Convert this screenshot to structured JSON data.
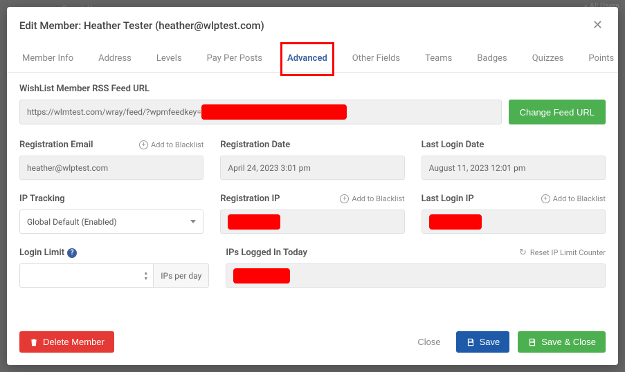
{
  "backdrop": {
    "search_users": "Search Users",
    "all_users": "« All Users"
  },
  "modal": {
    "title": "Edit Member: Heather Tester (heather@wlptest.com)"
  },
  "tabs": [
    {
      "label": "Member Info",
      "active": false
    },
    {
      "label": "Address",
      "active": false
    },
    {
      "label": "Levels",
      "active": false
    },
    {
      "label": "Pay Per Posts",
      "active": false
    },
    {
      "label": "Advanced",
      "active": true
    },
    {
      "label": "Other Fields",
      "active": false
    },
    {
      "label": "Teams",
      "active": false
    },
    {
      "label": "Badges",
      "active": false
    },
    {
      "label": "Quizzes",
      "active": false
    },
    {
      "label": "Points",
      "active": false
    }
  ],
  "feed": {
    "label": "WishList Member RSS Feed URL",
    "value": "https://wlmtest.com/wray/feed/?wpmfeedkey=",
    "change_btn": "Change Feed URL"
  },
  "row1": {
    "reg_email_label": "Registration Email",
    "reg_email_value": "heather@wlptest.com",
    "reg_date_label": "Registration Date",
    "reg_date_value": "April 24, 2023 3:01 pm",
    "last_login_date_label": "Last Login Date",
    "last_login_date_value": "August 11, 2023 12:01 pm",
    "add_blacklist": "Add to Blacklist"
  },
  "row2": {
    "ip_tracking_label": "IP Tracking",
    "ip_tracking_value": "Global Default (Enabled)",
    "reg_ip_label": "Registration IP",
    "last_login_ip_label": "Last Login IP",
    "add_blacklist": "Add to Blacklist"
  },
  "row3": {
    "login_limit_label": "Login Limit",
    "login_limit_value": "",
    "ips_per_day": "IPs per day",
    "ips_logged_today_label": "IPs Logged In Today",
    "reset_ip_counter": "Reset IP Limit Counter"
  },
  "footer": {
    "delete": "Delete Member",
    "close": "Close",
    "save": "Save",
    "save_close": "Save & Close"
  }
}
